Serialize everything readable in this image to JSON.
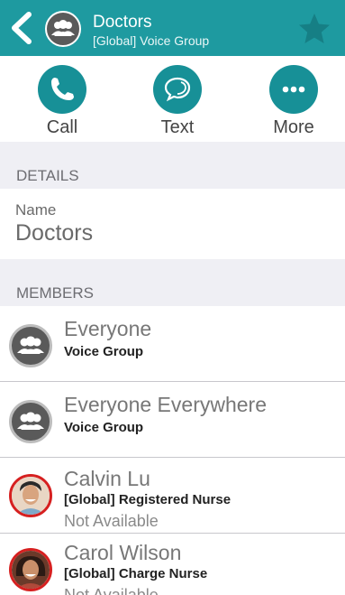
{
  "header": {
    "title": "Doctors",
    "subtitle": "[Global] Voice Group",
    "back_icon": "chevron-left-icon",
    "avatar_icon": "group-icon",
    "favorite_icon": "star-icon"
  },
  "actions": [
    {
      "label": "Call",
      "icon": "phone-icon"
    },
    {
      "label": "Text",
      "icon": "chat-bubble-icon"
    },
    {
      "label": "More",
      "icon": "ellipsis-icon"
    }
  ],
  "details": {
    "section_title": "DETAILS",
    "name_label": "Name",
    "name_value": "Doctors"
  },
  "members": {
    "section_title": "MEMBERS",
    "items": [
      {
        "title": "Everyone",
        "subtitle": "Voice Group",
        "status": "",
        "avatar": "group-icon"
      },
      {
        "title": "Everyone Everywhere",
        "subtitle": "Voice Group",
        "status": "",
        "avatar": "group-icon"
      },
      {
        "title": "Calvin Lu",
        "subtitle": "[Global] Registered Nurse",
        "status": "Not Available",
        "avatar": "person-photo"
      },
      {
        "title": "Carol Wilson",
        "subtitle": "[Global] Charge Nurse",
        "status": "Not Available",
        "avatar": "person-photo"
      }
    ]
  },
  "colors": {
    "header_bg": "#1e9aa0",
    "action_circle": "#179097",
    "section_bg": "#efeff4",
    "unavailable_ring": "#d62020"
  }
}
